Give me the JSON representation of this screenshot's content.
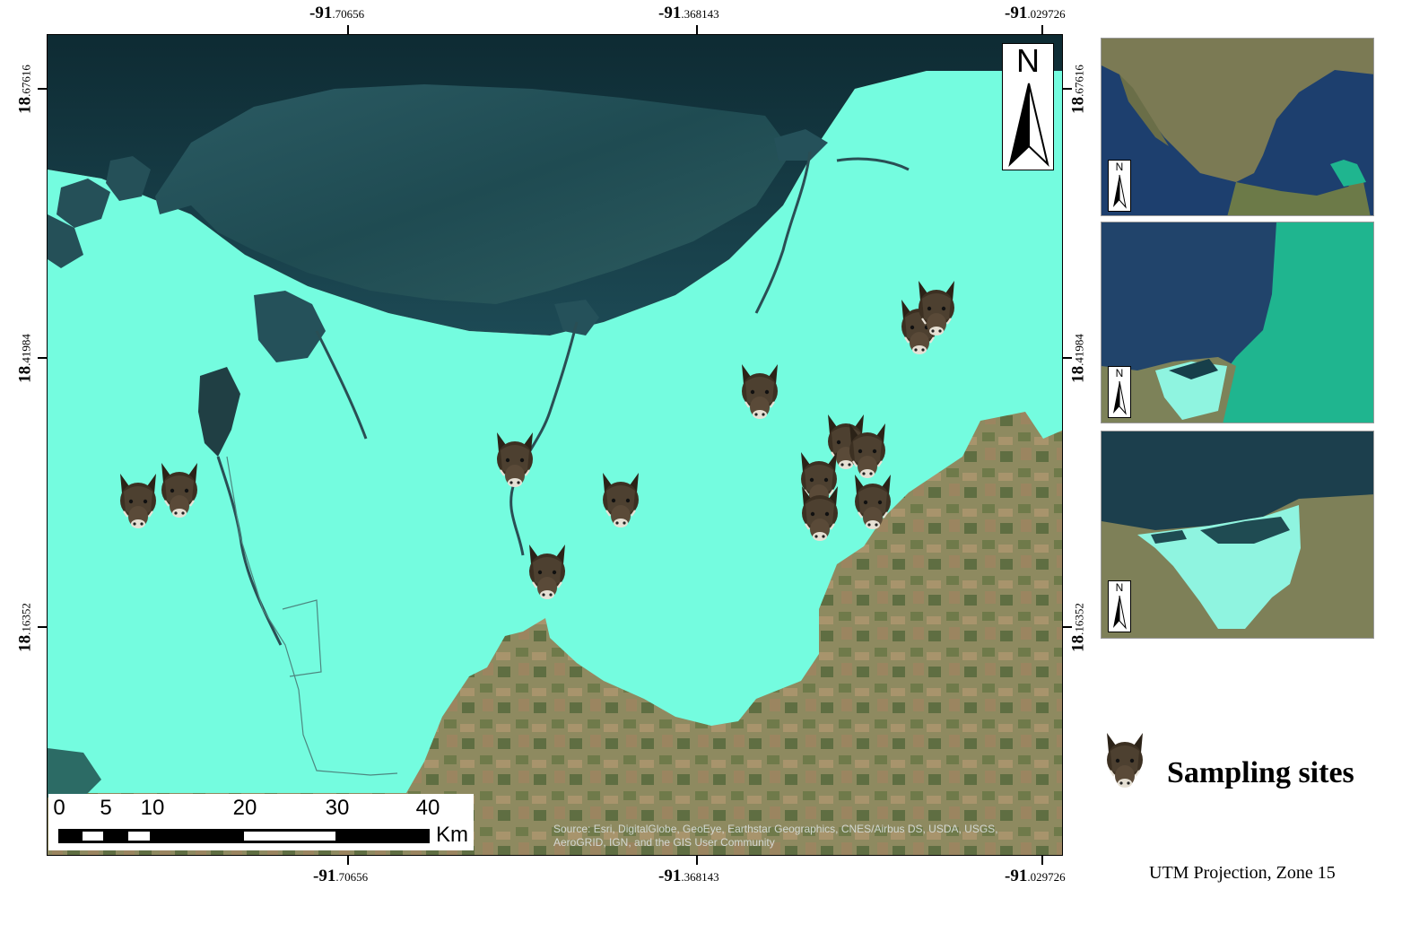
{
  "coords": {
    "top": [
      {
        "deg": "-91",
        "dec": ".70656"
      },
      {
        "deg": "-91",
        "dec": ".368143"
      },
      {
        "deg": "-91",
        "dec": ".029726"
      }
    ],
    "bottom": [
      {
        "deg": "-91",
        "dec": ".70656"
      },
      {
        "deg": "-91",
        "dec": ".368143"
      },
      {
        "deg": "-91",
        "dec": ".029726"
      }
    ],
    "left": [
      {
        "deg": "18",
        "dec": ".67616"
      },
      {
        "deg": "18",
        "dec": ".41984"
      },
      {
        "deg": "18",
        "dec": ".16352"
      }
    ],
    "right": [
      {
        "deg": "18",
        "dec": ".67616"
      },
      {
        "deg": "18",
        "dec": ".41984"
      },
      {
        "deg": "18",
        "dec": ".16352"
      }
    ]
  },
  "north_arrow": {
    "label": "N"
  },
  "inset_north": [
    "N",
    "N",
    "N"
  ],
  "scale_bar": {
    "labels": [
      "0",
      "5",
      "10",
      "20",
      "30",
      "40"
    ],
    "unit": "Km"
  },
  "attribution": "Source: Esri, DigitalGlobe, GeoEye, Earthstar Geographics, CNES/Airbus DS, USDA, USGS, AeroGRID, IGN, and the GIS User Community",
  "legend": {
    "label": "Sampling sites",
    "icon": "boar-head-icon"
  },
  "projection": "UTM Projection, Zone 15",
  "sampling_site_count": 13,
  "colors": {
    "study_area": "#74fcdf",
    "water": "#173f4a",
    "land": "#8f8a62",
    "state_highlight": "#1fb58f",
    "inset_area": "#8ff4e0"
  }
}
